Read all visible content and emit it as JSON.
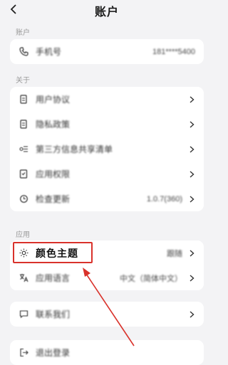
{
  "nav": {
    "title": "账户"
  },
  "section_account": {
    "label": "账户",
    "items": [
      {
        "label": "手机号",
        "value": "181****5400",
        "icon": "phone-icon"
      }
    ]
  },
  "section_about": {
    "label": "关于",
    "items": [
      {
        "label": "用户协议",
        "icon": "document-icon"
      },
      {
        "label": "隐私政策",
        "icon": "document-icon"
      },
      {
        "label": "第三方信息共享清单",
        "icon": "share-list-icon"
      },
      {
        "label": "应用权限",
        "icon": "permission-icon"
      },
      {
        "label": "检查更新",
        "value": "1.0.7(360)",
        "icon": "refresh-icon"
      }
    ]
  },
  "section_app": {
    "label": "应用",
    "items": [
      {
        "label": "颜色主题",
        "value": "跟随",
        "icon": "sun-icon"
      },
      {
        "label": "应用语言",
        "value": "中文（简体中文）",
        "icon": "language-icon"
      }
    ]
  },
  "contact": {
    "label": "联系我们",
    "icon": "chat-icon"
  },
  "logout": {
    "label": "退出登录",
    "icon": "logout-icon"
  },
  "colors": {
    "highlight": "#d9322b",
    "background": "#f3f3f5",
    "card": "#ffffff"
  }
}
